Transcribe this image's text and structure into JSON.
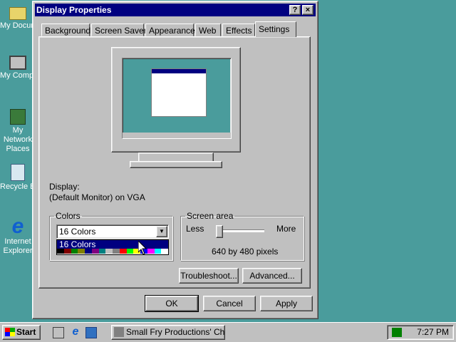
{
  "desktop": {
    "icons": [
      {
        "label": "My Documents",
        "icon": "folder-icon"
      },
      {
        "label": "My Computer",
        "icon": "computer-icon"
      },
      {
        "label": "My Network Places",
        "icon": "network-icon"
      },
      {
        "label": "Recycle Bin",
        "icon": "recycle-bin-icon"
      },
      {
        "label": "Internet Explorer",
        "icon": "ie-icon"
      }
    ]
  },
  "window": {
    "title": "Display Properties",
    "help_label": "?",
    "close_label": "×",
    "tabs": [
      {
        "label": "Background"
      },
      {
        "label": "Screen Saver"
      },
      {
        "label": "Appearance"
      },
      {
        "label": "Web"
      },
      {
        "label": "Effects"
      },
      {
        "label": "Settings"
      }
    ],
    "active_tab": "Settings",
    "display_label": "Display:",
    "display_value": "(Default Monitor) on VGA",
    "colors": {
      "legend": "Colors",
      "selected": "16 Colors",
      "options": [
        "16 Colors"
      ],
      "palette": [
        "#000000",
        "#800000",
        "#008000",
        "#808000",
        "#000080",
        "#800080",
        "#008080",
        "#c0c0c0",
        "#808080",
        "#ff0000",
        "#00ff00",
        "#ffff00",
        "#0000ff",
        "#ff00ff",
        "#00ffff",
        "#ffffff"
      ]
    },
    "screen_area": {
      "legend": "Screen area",
      "less_label": "Less",
      "more_label": "More",
      "value_text": "640 by 480 pixels",
      "slider_fraction": 0
    },
    "buttons": {
      "troubleshoot": "Troubleshoot...",
      "advanced": "Advanced...",
      "ok": "OK",
      "cancel": "Cancel",
      "apply": "Apply"
    }
  },
  "taskbar": {
    "start_label": "Start",
    "task_label": "Small Fry Productions' Chil...",
    "clock": "7:27 PM"
  },
  "colors": {
    "desktop": "#4a9c9c",
    "titlebar": "#000080",
    "face": "#c0c0c0"
  }
}
